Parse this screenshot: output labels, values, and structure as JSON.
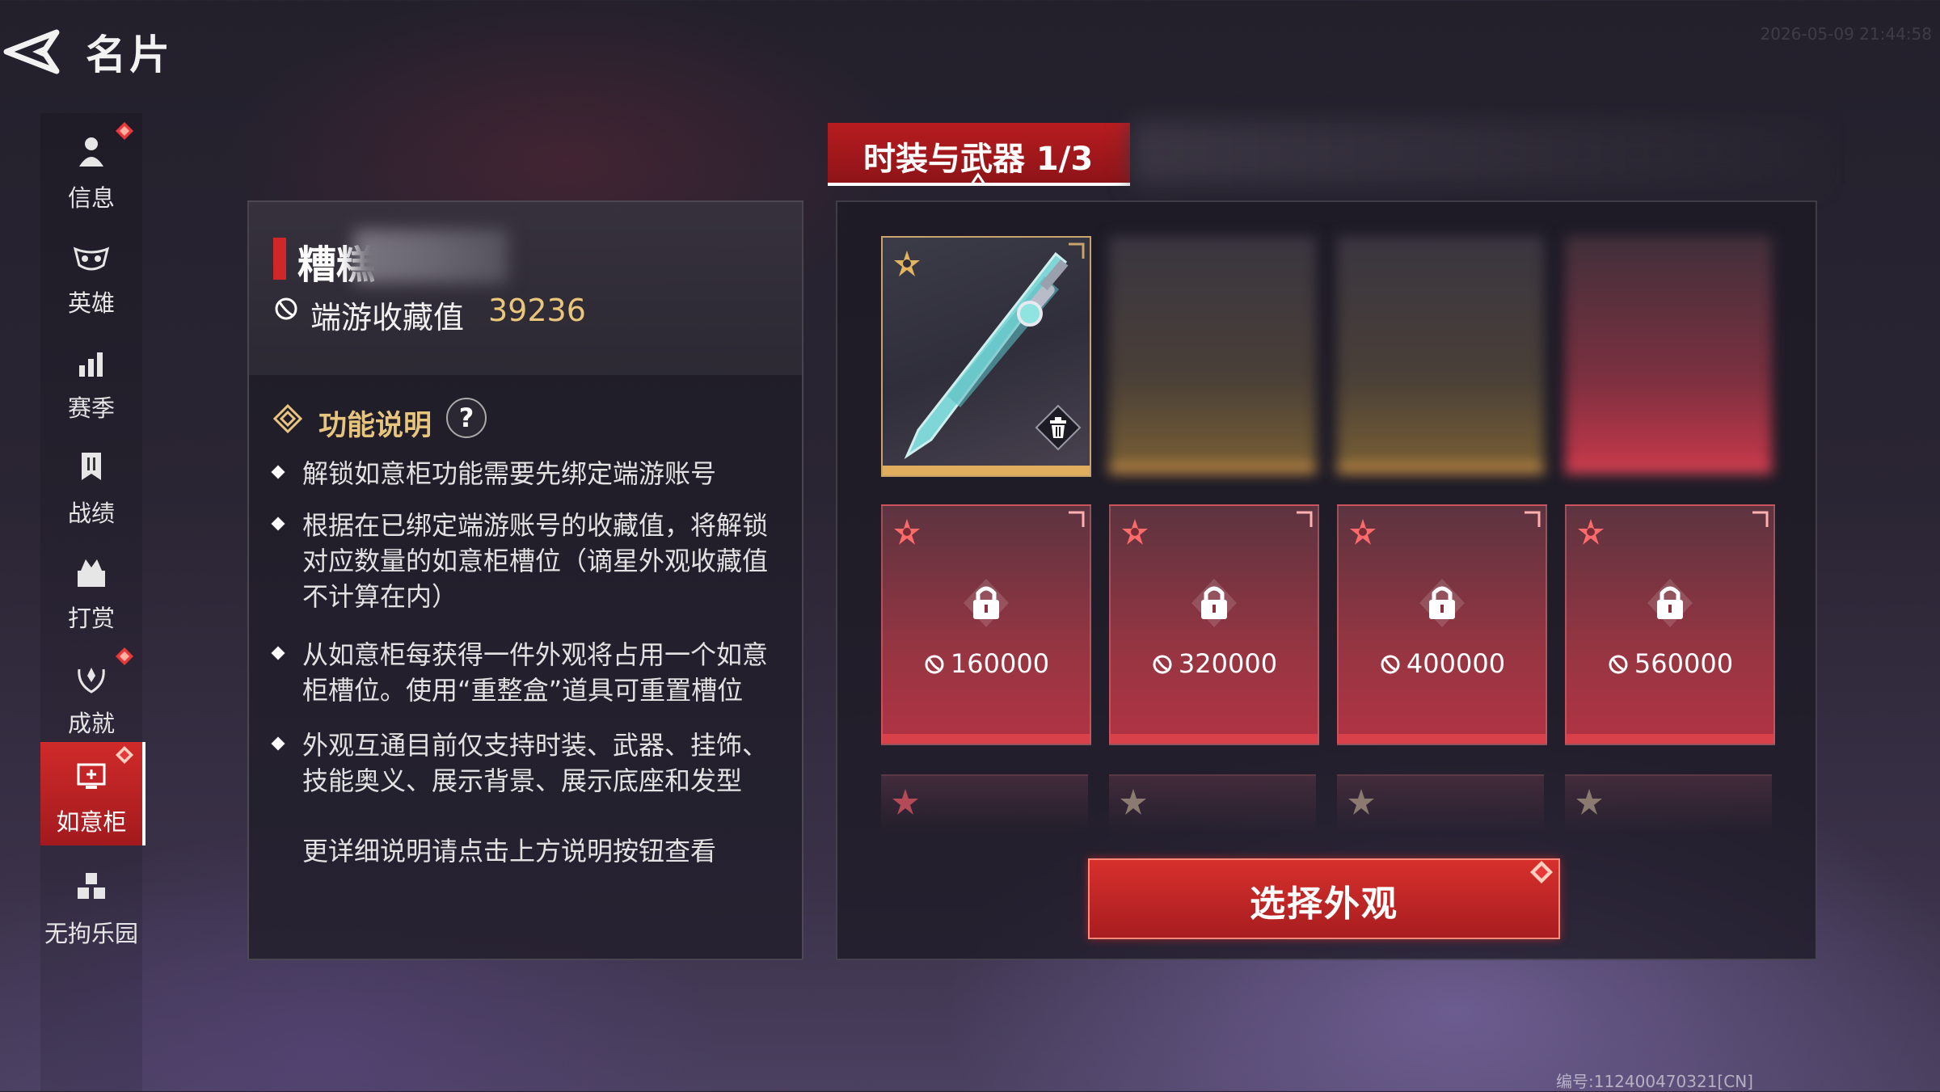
{
  "header": {
    "title": "名片",
    "timestamp": "2026-05-09 21:44:58"
  },
  "sidebar": {
    "items": [
      {
        "label": "信息",
        "icon": "person-icon",
        "badge": true
      },
      {
        "label": "英雄",
        "icon": "mask-icon",
        "badge": false
      },
      {
        "label": "赛季",
        "icon": "bar-chart-icon",
        "badge": false
      },
      {
        "label": "战绩",
        "icon": "banner-icon",
        "badge": false
      },
      {
        "label": "打赏",
        "icon": "gift-icon",
        "badge": false
      },
      {
        "label": "成就",
        "icon": "laurel-icon",
        "badge": true
      },
      {
        "label": "如意柜",
        "icon": "cabinet-icon",
        "badge": true,
        "active": true
      },
      {
        "label": "无拘乐园",
        "icon": "cubes-icon",
        "badge": false
      }
    ]
  },
  "info": {
    "name_visible": "糟糕",
    "collection_label": "端游收藏值",
    "collection_value": "39236",
    "function_title": "功能说明",
    "help_symbol": "?",
    "bullets": [
      "解锁如意柜功能需要先绑定端游账号",
      "根据在已绑定端游账号的收藏值，将解锁对应数量的如意柜槽位（谪星外观收藏值不计算在内）",
      "从如意柜每获得一件外观将占用一个如意柜槽位。使用“重整盒”道具可重置槽位",
      "外观互通目前仅支持时装、武器、挂饰、技能奥义、展示背景、展示底座和发型"
    ],
    "more_text": "更详细说明请点击上方说明按钮查看"
  },
  "tabs": {
    "active_label": "时装与武器 1/3"
  },
  "slots": {
    "locked_costs": [
      "160000",
      "320000",
      "400000",
      "560000"
    ]
  },
  "select_button": {
    "label": "选择外观"
  },
  "footer": {
    "serial": "编号:112400470321[CN]"
  },
  "colors": {
    "accent_red": "#c8282c",
    "gold": "#e1ad5e",
    "collection_gold": "#e9c67a"
  }
}
